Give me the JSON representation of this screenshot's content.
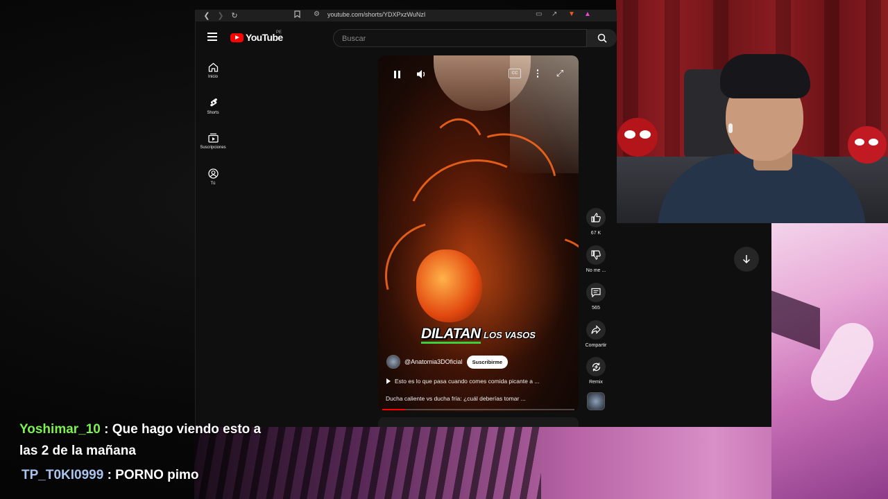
{
  "browser": {
    "url": "youtube.com/shorts/YDXPxzWuNzI",
    "icons": [
      "back-icon",
      "forward-icon",
      "reload-icon",
      "bookmark-icon",
      "site-settings-icon",
      "cast-icon",
      "share-icon",
      "brave-shield-icon",
      "brave-rewards-icon"
    ]
  },
  "youtube": {
    "logo_text": "YouTube",
    "region": "PE",
    "search_placeholder": "Buscar",
    "sidebar": [
      {
        "icon": "home-icon",
        "label": "Inicio"
      },
      {
        "icon": "shorts-icon",
        "label": "Shorts"
      },
      {
        "icon": "subscriptions-icon",
        "label": "Suscripciones"
      },
      {
        "icon": "account-icon",
        "label": "Tú"
      }
    ]
  },
  "short": {
    "caption_big": "DILATAN",
    "caption_small": "LOS VASOS",
    "channel": "@Anatomia3DOficial",
    "subscribe_label": "Suscribirme",
    "playlist_text": "Esto es lo que pasa cuando comes comida picante a ...",
    "description": "Ducha caliente vs ducha fría: ¿cuál deberías tomar ...",
    "progress_fraction": 0.12,
    "colors": {
      "accent": "#ff0000",
      "artery": "#ff6a1a",
      "caption_underline": "#3bd13b"
    }
  },
  "actions": {
    "like_count": "67 K",
    "dislike_label": "No me ...",
    "comments_count": "565",
    "share_label": "Compartir",
    "remix_label": "Remix"
  },
  "chat": [
    {
      "user": "Yoshimar_10",
      "message": " : Que hago viendo esto a las 2 de la mañana",
      "user_color": "#7cf24f"
    },
    {
      "user": "TP_T0KI0999",
      "message": " : PORNO pimo",
      "user_color": "#a9c4ee"
    }
  ]
}
